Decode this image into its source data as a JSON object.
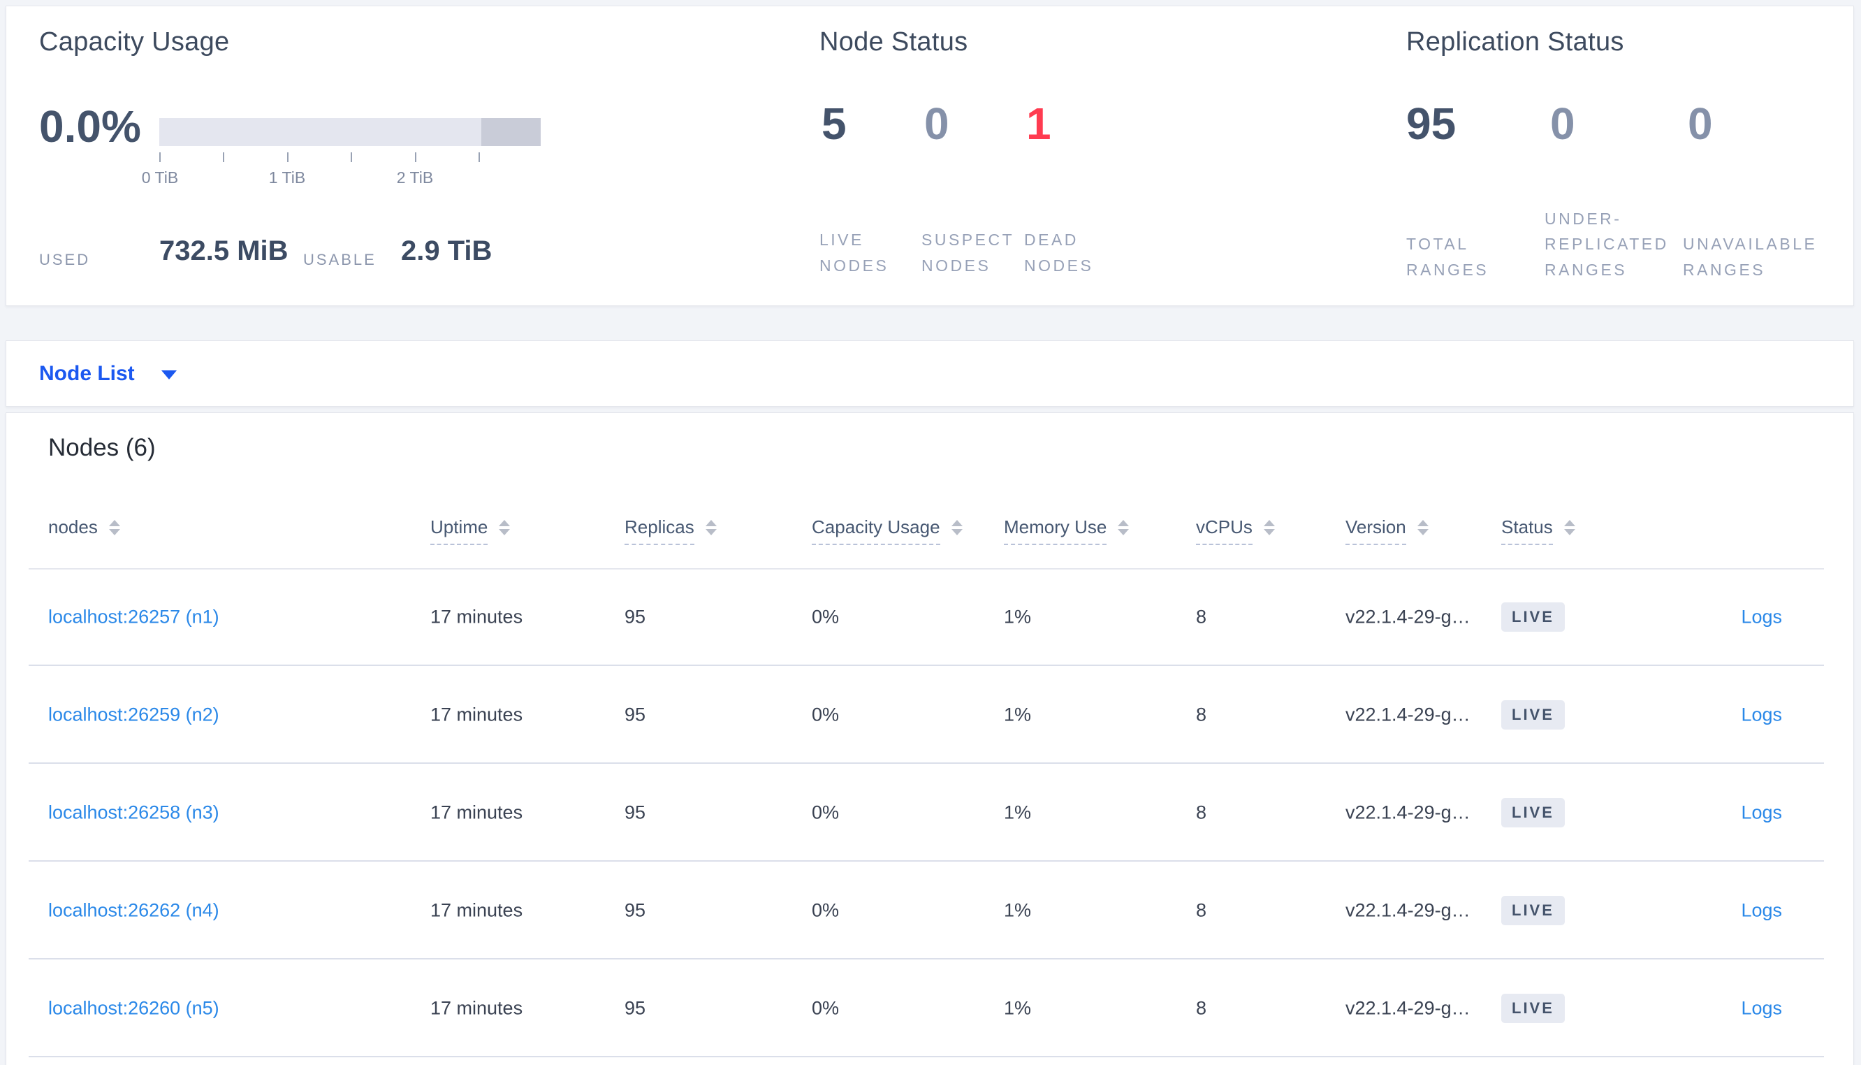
{
  "summary": {
    "capacity": {
      "title": "Capacity Usage",
      "percent": "0.0%",
      "axis_ticks": [
        "0 TiB",
        "1 TiB",
        "2 TiB"
      ],
      "used_label": "USED",
      "used_value": "732.5 MiB",
      "usable_label": "USABLE",
      "usable_value": "2.9 TiB"
    },
    "node_status": {
      "title": "Node Status",
      "stats": [
        {
          "value": "5",
          "label": "LIVE NODES"
        },
        {
          "value": "0",
          "label": "SUSPECT NODES"
        },
        {
          "value": "1",
          "label": "DEAD NODES"
        }
      ]
    },
    "replication": {
      "title": "Replication Status",
      "stats": [
        {
          "value": "95",
          "label": "TOTAL RANGES"
        },
        {
          "value": "0",
          "label": "UNDER-REPLICATED RANGES"
        },
        {
          "value": "0",
          "label": "UNAVAILABLE RANGES"
        }
      ]
    }
  },
  "view_selector": {
    "label": "Node List"
  },
  "table": {
    "title": "Nodes (6)",
    "columns": [
      {
        "label": "nodes"
      },
      {
        "label": "Uptime"
      },
      {
        "label": "Replicas"
      },
      {
        "label": "Capacity Usage"
      },
      {
        "label": "Memory Use"
      },
      {
        "label": "vCPUs"
      },
      {
        "label": "Version"
      },
      {
        "label": "Status"
      }
    ],
    "rows": [
      {
        "node": "localhost:26257 (n1)",
        "uptime": "17 minutes",
        "replicas": "95",
        "capacity": "0%",
        "memory": "1%",
        "vcpus": "8",
        "version": "v22.1.4-29-g…",
        "status": "LIVE",
        "logs": "Logs"
      },
      {
        "node": "localhost:26259 (n2)",
        "uptime": "17 minutes",
        "replicas": "95",
        "capacity": "0%",
        "memory": "1%",
        "vcpus": "8",
        "version": "v22.1.4-29-g…",
        "status": "LIVE",
        "logs": "Logs"
      },
      {
        "node": "localhost:26258 (n3)",
        "uptime": "17 minutes",
        "replicas": "95",
        "capacity": "0%",
        "memory": "1%",
        "vcpus": "8",
        "version": "v22.1.4-29-g…",
        "status": "LIVE",
        "logs": "Logs"
      },
      {
        "node": "localhost:26262 (n4)",
        "uptime": "17 minutes",
        "replicas": "95",
        "capacity": "0%",
        "memory": "1%",
        "vcpus": "8",
        "version": "v22.1.4-29-g…",
        "status": "LIVE",
        "logs": "Logs"
      },
      {
        "node": "localhost:26260 (n5)",
        "uptime": "17 minutes",
        "replicas": "95",
        "capacity": "0%",
        "memory": "1%",
        "vcpus": "8",
        "version": "v22.1.4-29-g…",
        "status": "LIVE",
        "logs": "Logs"
      }
    ]
  },
  "colors": {
    "accent_blue": "#1b58f0",
    "link_blue": "#2a88e8",
    "danger_red": "#ff3b50",
    "dark_slate": "#44536b",
    "muted_slate": "#8591a9",
    "bar_light": "#e4e6ef",
    "bar_dark": "#c9ccd8",
    "badge_bg": "#e7eaf2",
    "page_bg": "#f2f4f8"
  }
}
